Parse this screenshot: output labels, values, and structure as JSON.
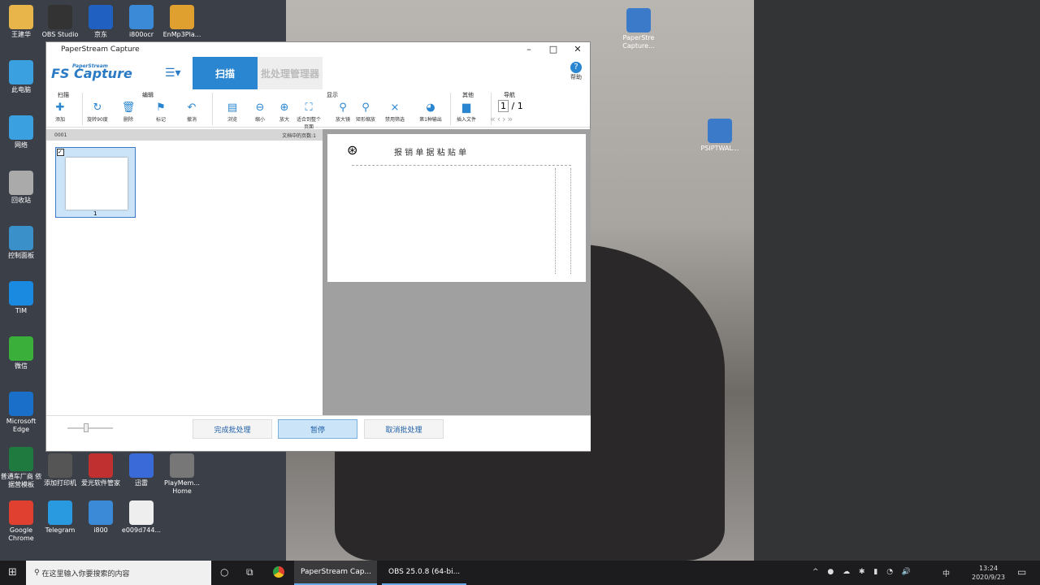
{
  "desktop": {
    "left_icons": [
      {
        "label": "王建华",
        "color": "#e8b54a"
      },
      {
        "label": "OBS Studio",
        "color": "#333"
      },
      {
        "label": "京东",
        "color": "#2060c0"
      },
      {
        "label": "i800ocr",
        "color": "#3a8ad8"
      },
      {
        "label": "EnMp3Pla...",
        "color": "#e0a030"
      },
      {
        "label": "此电脑",
        "color": "#3aa0e0"
      },
      {
        "label": "网络",
        "color": "#3aa0e0"
      },
      {
        "label": "回收站",
        "color": "#aaa"
      },
      {
        "label": "控制面板",
        "color": "#3a90c8"
      },
      {
        "label": "TIM",
        "color": "#1a8ae0"
      },
      {
        "label": "微信",
        "color": "#3ab03a"
      },
      {
        "label": "Microsoft Edge",
        "color": "#1a70c8"
      },
      {
        "label": "普通车厂商 依据营模板",
        "color": "#1e7a3e"
      },
      {
        "label": "添加打印机",
        "color": "#555"
      },
      {
        "label": "爱光软件管家",
        "color": "#c03030"
      },
      {
        "label": "迅雷",
        "color": "#3a6ad8"
      },
      {
        "label": "PlayMem... Home",
        "color": "#777"
      },
      {
        "label": "Google Chrome",
        "color": "#e04030"
      },
      {
        "label": "Telegram",
        "color": "#2a9ae0"
      },
      {
        "label": "i800",
        "color": "#3a8ad8"
      },
      {
        "label": "e009d744...",
        "color": "#eee"
      }
    ],
    "right_icons": [
      {
        "label": "PaperStre Capture...",
        "color": "#3a7ac8"
      },
      {
        "label": "PSIPTWAL...",
        "color": "#3a7ac8"
      }
    ]
  },
  "window": {
    "title": "PaperStream Capture",
    "logo_top": "PaperStream",
    "logo": "Capture",
    "tab_scan": "扫描",
    "tab_batch": "批处理管理器",
    "help": "帮助",
    "groups": {
      "scan": "扫描",
      "edit": "编辑",
      "view": "显示",
      "other": "其他",
      "nav": "导航"
    },
    "tools": [
      "添加",
      "旋转90度",
      "删除",
      "标记",
      "撤消",
      "浏览",
      "缩小",
      "放大",
      "适合到整个页面",
      "放大镜",
      "矩形缩放",
      "禁用筛选",
      "第1种输出",
      "插入文件"
    ],
    "page_current": "1",
    "page_total": "/ 1",
    "batch_id": "0001",
    "page_count": "文档中的页数:1",
    "thumb_number": "1",
    "doc_title": "报 销 单 据 粘 贴 单",
    "buttons": {
      "finish": "完成批处理",
      "pause": "暂停",
      "cancel": "取消批处理"
    }
  },
  "taskbar": {
    "search_placeholder": "在这里输入你要搜索的内容",
    "apps": [
      "PaperStream Cap...",
      "OBS 25.0.8 (64-bi..."
    ],
    "ime": "中",
    "time": "13:24",
    "date": "2020/9/23"
  }
}
